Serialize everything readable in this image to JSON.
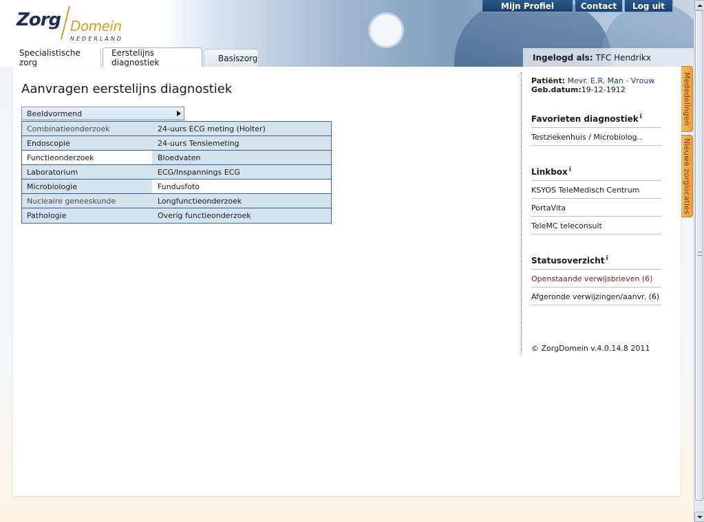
{
  "header": {
    "logo": {
      "part1": "Zorg",
      "part2": "Domein",
      "sub": "NEDERLAND"
    },
    "topnav": [
      "Mijn Profiel",
      "Contact",
      "Log uit"
    ],
    "tabs": [
      "Specialistische zorg",
      "Eerstelijns diagnostiek",
      "Basiszorg"
    ],
    "active_tab": 1,
    "logged_in_label": "Ingelogd als:",
    "logged_in_user": "TFC Hendrikx"
  },
  "main": {
    "title": "Aanvragen eerstelijns diagnostiek",
    "dropdown": {
      "label": "Beeldvormend"
    },
    "rows": [
      {
        "left": "Combinatieonderzoek",
        "right": "24-uurs ECG meting (Holter)"
      },
      {
        "left": "Endoscopie",
        "right": "24-uurs Tensiemeting"
      },
      {
        "left": "Functieonderzoek",
        "right": "Bloedvaten"
      },
      {
        "left": "Laboratorium",
        "right": "ECG/Inspannings ECG"
      },
      {
        "left": "Microbiologie",
        "right": "Fundusfoto"
      },
      {
        "left": "Nucleaire geneeskunde",
        "right": "Longfunctieonderzoek"
      },
      {
        "left": "Pathologie",
        "right": "Overig functieonderzoek"
      }
    ]
  },
  "sidebar": {
    "patient_label": "Patiënt:",
    "patient_value": "Mevr. E.R. Man - Vrouw",
    "dob_label": "Geb.datum:",
    "dob_value": "19-12-1912",
    "favorieten": {
      "title": "Favorieten diagnostiek",
      "info": "i",
      "items": [
        "Testziekenhuis / Microbiolog.."
      ]
    },
    "linkbox": {
      "title": "Linkbox",
      "info": "i",
      "items": [
        "KSYOS TeleMedisch Centrum",
        "PortaVita",
        "TeleMC teleconsult"
      ]
    },
    "status": {
      "title": "Statusoverzicht",
      "info": "i",
      "items": [
        "Openstaande verwijsbrieven (6)",
        "Afgeronde verwijzingen/aanvr. (6)"
      ]
    },
    "copyright": "© ZorgDomein v.4.0.14.8 2011"
  },
  "side_tabs": [
    "Mededelingen",
    "Nieuwe zorglocaties"
  ],
  "colors": {
    "brand_navy": "#1c2f52",
    "brand_orange": "#d89a27",
    "row_blue": "#d4e3f0",
    "status_red": "#8a1a1a"
  }
}
